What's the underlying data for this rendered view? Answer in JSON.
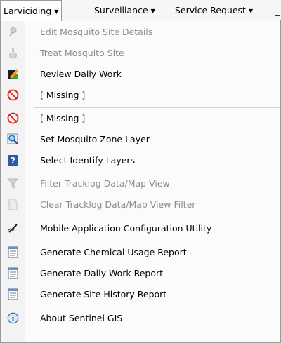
{
  "menubar": {
    "tabs": [
      {
        "label": "Larviciding",
        "active": true
      },
      {
        "label": "Surveillance",
        "active": false
      },
      {
        "label": "Service Request",
        "active": false
      }
    ]
  },
  "menu": {
    "items": [
      {
        "label": "Edit Mosquito Site Details",
        "icon": "mosquito-pin-icon",
        "enabled": false
      },
      {
        "label": "Treat Mosquito Site",
        "icon": "spray-bottle-icon",
        "enabled": false
      },
      {
        "label": "Review Daily Work",
        "icon": "pencil-clipboard-icon",
        "enabled": true
      },
      {
        "label": "[ Missing ]",
        "icon": "prohibited-icon",
        "enabled": true
      },
      {
        "label": "[ Missing ]",
        "icon": "prohibited-icon",
        "enabled": true
      },
      {
        "label": "Set Mosquito Zone Layer",
        "icon": "zone-magnifier-icon",
        "enabled": true
      },
      {
        "label": "Select Identify Layers",
        "icon": "help-question-icon",
        "enabled": true
      },
      {
        "label": "Filter Tracklog Data/Map View",
        "icon": "filter-funnel-icon",
        "enabled": false
      },
      {
        "label": "Clear Tracklog Data/Map View Filter",
        "icon": "blank-page-icon",
        "enabled": false
      },
      {
        "label": "Mobile Application Configuration Utility",
        "icon": "pen-configure-icon",
        "enabled": true
      },
      {
        "label": "Generate Chemical Usage Report",
        "icon": "report-document-icon",
        "enabled": true
      },
      {
        "label": "Generate Daily Work Report",
        "icon": "report-document-icon",
        "enabled": true
      },
      {
        "label": "Generate Site History Report",
        "icon": "report-document-icon",
        "enabled": true
      },
      {
        "label": "About Sentinel GIS",
        "icon": "info-icon",
        "enabled": true
      }
    ]
  }
}
